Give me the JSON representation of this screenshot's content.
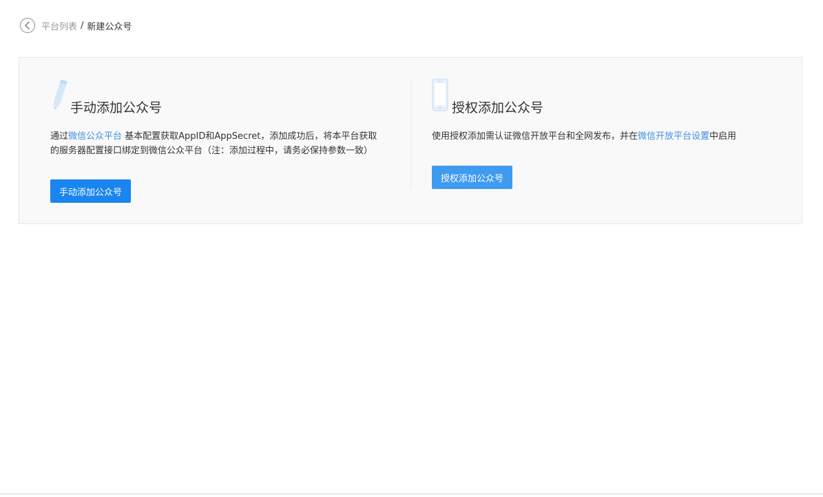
{
  "breadcrumb": {
    "back_icon": "chevron-left-icon",
    "parent": "平台列表",
    "separator": "/",
    "current": "新建公众号"
  },
  "manual": {
    "icon": "pen-icon",
    "title": "手动添加公众号",
    "desc_prefix": "通过",
    "desc_link": "微信公众平台",
    "desc_suffix": " 基本配置获取AppID和AppSecret，添加成功后，将本平台获取",
    "desc_line2": "的服务器配置接口绑定到微信公众平台（注：添加过程中，请务必保持参数一致）",
    "button_label": "手动添加公众号"
  },
  "authorize": {
    "icon": "phone-icon",
    "title": "授权添加公众号",
    "desc_prefix": "使用授权添加需认证微信开放平台和全网发布，并在",
    "desc_link": "微信开放平台设置",
    "desc_suffix": "中启用",
    "button_label": "授权添加公众号"
  },
  "colors": {
    "primary_button": "#1a85ee",
    "secondary_button": "#3e9bf0",
    "link": "#3e8fe6",
    "panel_bg": "#f9f9f9"
  }
}
